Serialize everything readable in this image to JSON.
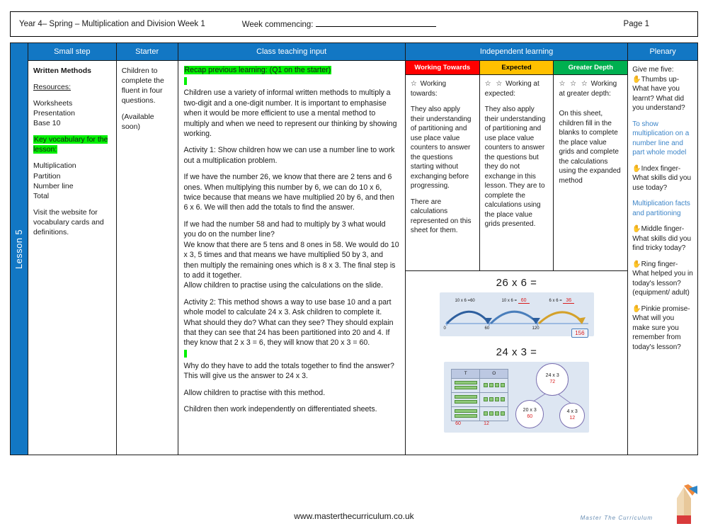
{
  "header": {
    "title": "Year 4– Spring – Multiplication and Division Week 1",
    "week_commencing_label": "Week commencing: ",
    "page": "Page 1"
  },
  "lesson_tab": "Lesson 5",
  "columns": {
    "small_step": "Small step",
    "starter": "Starter",
    "class_teaching_input": "Class teaching input",
    "independent_learning": "Independent learning",
    "plenary": "Plenary"
  },
  "small_step": {
    "heading": "Written Methods",
    "resources_label": "Resources:",
    "resources": [
      "Worksheets",
      "Presentation",
      "Base 10"
    ],
    "key_vocab_label": "Key vocabulary for the lesson:",
    "vocab": [
      "Multiplication",
      "Partition",
      "Number line",
      "Total"
    ],
    "website_note": "Visit the website for vocabulary cards and definitions."
  },
  "starter": {
    "line1": "Children to complete the fluent in four questions.",
    "line2": "(Available soon)"
  },
  "teaching": {
    "recap_highlight": "Recap previous learning: (Q1 on the starter)",
    "p1": "Children use a variety of informal written methods to multiply a two-digit and a one-digit number. It is important to emphasise when it would be more efficient to use a mental method to multiply and when we need to represent our thinking by showing working.",
    "p2": "Activity 1: Show children how we can use a number line to work out a multiplication problem.",
    "p3": "If we have the number 26, we know that there are 2 tens and 6 ones. When multiplying this number by 6, we can do 10 x 6, twice because that means we have multiplied 20 by 6, and then 6 x 6. We will then add the totals to find the answer.",
    "p4": "If we had the number 58 and had to multiply by 3 what would you do on the number line?",
    "p5": "We know that there are 5 tens and 8 ones in 58. We would do 10 x 3, 5 times and that means we have multiplied 50 by 3, and then multiply the remaining ones which is 8 x 3. The final step is to add it together.",
    "p6": "Allow children to practise using the calculations on the slide.",
    "p7": "Activity 2: This method shows a way to use base 10 and a part whole model to calculate 24 x 3. Ask children to complete it. What should they do? What can they see? They should explain that they can see that 24 has been partitioned into 20 and 4. If they know that 2 x 3 = 6, they will know that 20 x 3 = 60.",
    "p8": "Why do they have to add the totals together to find the answer? This will give us the answer to 24 x 3.",
    "p9": "Allow children to practise with this method.",
    "p10": "Children then work independently on differentiated sheets."
  },
  "independent": {
    "groups": [
      {
        "header": "Working Towards",
        "header_color": "#ff0000",
        "stars": "☆",
        "star_line": "Working towards:",
        "body1": "They also apply their understanding of partitioning and use place value counters to answer the questions starting without exchanging before progressing.",
        "body2": "There are calculations represented on this sheet for them."
      },
      {
        "header": "Expected",
        "header_color": "#ffc000",
        "stars": "☆ ☆",
        "star_line": "Working at expected:",
        "body1": "They also apply their understanding of partitioning and use place value counters to answer the questions but they do not exchange in this lesson. They are to complete the calculations using the place value grids presented.",
        "body2": ""
      },
      {
        "header": "Greater Depth",
        "header_color": "#00b050",
        "stars": "☆ ☆ ☆",
        "star_line": "Working at greater depth:",
        "body1": "On this sheet, children fill in the blanks to complete the place value grids and complete the calculations using the expanded method",
        "body2": ""
      }
    ]
  },
  "diagram_numberline": {
    "title": "26 x 6 =",
    "jumps": [
      {
        "label": "10 x 6 =",
        "value": "60",
        "filled": true
      },
      {
        "label": "10 x 6 =",
        "value": "60",
        "filled": false
      },
      {
        "label": "6 x 6 =",
        "value": "36",
        "filled": false
      }
    ],
    "ticks": [
      "0",
      "60",
      "120"
    ],
    "answer": "156"
  },
  "diagram_partwhole": {
    "title": "24 x 3 =",
    "grid_headers": [
      "T",
      "O"
    ],
    "grid_rows": [
      {
        "tens": 2,
        "ones": 4
      },
      {
        "tens": 2,
        "ones": 4
      },
      {
        "tens": 2,
        "ones": 4
      }
    ],
    "grid_totals": [
      "60",
      "12"
    ],
    "whole": {
      "label": "24 x 3",
      "value": "72"
    },
    "part_left": {
      "label": "20 x 3",
      "value": "60"
    },
    "part_right": {
      "label": "4 x 3",
      "value": "12"
    }
  },
  "plenary": {
    "intro": "Give me five:",
    "items": [
      {
        "icon": "✋",
        "question": "Thumbs up- What have you learnt? What did you understand?",
        "answer": "To show multiplication on a number line and part whole model"
      },
      {
        "icon": "✋",
        "question": "Index finger- What skills did you use today?",
        "answer": "Multiplication facts and partitioning"
      },
      {
        "icon": "✋",
        "question": "Middle finger- What skills did you find tricky today?",
        "answer": ""
      },
      {
        "icon": "✋",
        "question": "Ring finger- What helped you in today's lesson? (equipment/ adult)",
        "answer": ""
      },
      {
        "icon": "✋",
        "question": "Pinkie promise- What will you make sure you remember from today's lesson?",
        "answer": ""
      }
    ]
  },
  "footer": {
    "url": "www.masterthecurriculum.co.uk",
    "logo_text": "Master The Curriculum"
  }
}
